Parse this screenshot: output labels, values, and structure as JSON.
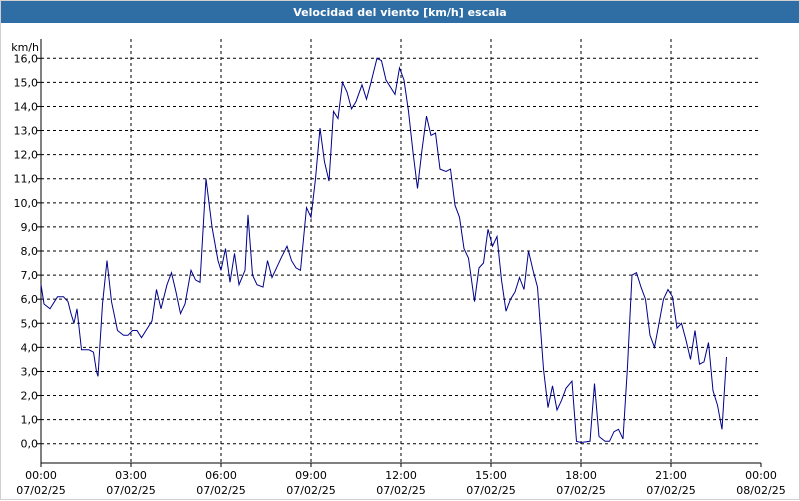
{
  "window": {
    "title": "Velocidad del viento [km/h] escala"
  },
  "colors": {
    "titlebar_bg": "#2f6ea5",
    "line": "#00008b",
    "grid": "#000000"
  },
  "chart_data": {
    "type": "line",
    "title": "Velocidad del viento [km/h] escala",
    "ylabel": "km/h",
    "ylim": [
      -0.8,
      16.8
    ],
    "xlim_hours": [
      0,
      24
    ],
    "y_ticks": [
      "0,0",
      "1,0",
      "2,0",
      "3,0",
      "4,0",
      "5,0",
      "6,0",
      "7,0",
      "8,0",
      "9,0",
      "10,0",
      "11,0",
      "12,0",
      "13,0",
      "14,0",
      "15,0",
      "16,0"
    ],
    "x_ticks": [
      {
        "time": "00:00",
        "date": "07/02/25"
      },
      {
        "time": "03:00",
        "date": "07/02/25"
      },
      {
        "time": "06:00",
        "date": "07/02/25"
      },
      {
        "time": "09:00",
        "date": "07/02/25"
      },
      {
        "time": "12:00",
        "date": "07/02/25"
      },
      {
        "time": "15:00",
        "date": "07/02/25"
      },
      {
        "time": "18:00",
        "date": "07/02/25"
      },
      {
        "time": "21:00",
        "date": "07/02/25"
      },
      {
        "time": "00:00",
        "date": "08/02/25"
      }
    ],
    "grid": true,
    "series": [
      {
        "values": [
          [
            0.0,
            6.6
          ],
          [
            0.1,
            5.8
          ],
          [
            0.3,
            5.6
          ],
          [
            0.55,
            6.1
          ],
          [
            0.75,
            6.1
          ],
          [
            0.9,
            5.9
          ],
          [
            1.0,
            5.4
          ],
          [
            1.1,
            5.0
          ],
          [
            1.2,
            5.6
          ],
          [
            1.35,
            3.9
          ],
          [
            1.6,
            3.9
          ],
          [
            1.75,
            3.8
          ],
          [
            1.85,
            3.0
          ],
          [
            1.9,
            2.8
          ],
          [
            2.05,
            5.8
          ],
          [
            2.2,
            7.6
          ],
          [
            2.35,
            5.9
          ],
          [
            2.55,
            4.7
          ],
          [
            2.75,
            4.5
          ],
          [
            2.9,
            4.5
          ],
          [
            3.05,
            4.7
          ],
          [
            3.2,
            4.7
          ],
          [
            3.35,
            4.4
          ],
          [
            3.55,
            4.8
          ],
          [
            3.7,
            5.1
          ],
          [
            3.85,
            6.4
          ],
          [
            4.0,
            5.6
          ],
          [
            4.2,
            6.6
          ],
          [
            4.35,
            7.1
          ],
          [
            4.5,
            6.3
          ],
          [
            4.65,
            5.4
          ],
          [
            4.8,
            5.8
          ],
          [
            5.0,
            7.2
          ],
          [
            5.15,
            6.8
          ],
          [
            5.3,
            6.7
          ],
          [
            5.5,
            11.0
          ],
          [
            5.7,
            9.0
          ],
          [
            5.9,
            7.6
          ],
          [
            6.0,
            7.2
          ],
          [
            6.15,
            8.1
          ],
          [
            6.3,
            6.7
          ],
          [
            6.45,
            7.9
          ],
          [
            6.6,
            6.6
          ],
          [
            6.8,
            7.2
          ],
          [
            6.9,
            9.5
          ],
          [
            7.05,
            7.0
          ],
          [
            7.2,
            6.6
          ],
          [
            7.4,
            6.5
          ],
          [
            7.55,
            7.6
          ],
          [
            7.7,
            6.9
          ],
          [
            7.85,
            7.3
          ],
          [
            8.0,
            7.7
          ],
          [
            8.2,
            8.2
          ],
          [
            8.35,
            7.6
          ],
          [
            8.5,
            7.3
          ],
          [
            8.65,
            7.2
          ],
          [
            8.85,
            9.8
          ],
          [
            9.0,
            9.4
          ],
          [
            9.15,
            11.0
          ],
          [
            9.3,
            13.1
          ],
          [
            9.45,
            11.7
          ],
          [
            9.6,
            10.9
          ],
          [
            9.75,
            13.8
          ],
          [
            9.9,
            13.5
          ],
          [
            10.05,
            15.0
          ],
          [
            10.2,
            14.6
          ],
          [
            10.35,
            13.9
          ],
          [
            10.5,
            14.2
          ],
          [
            10.7,
            14.9
          ],
          [
            10.85,
            14.3
          ],
          [
            11.0,
            15.0
          ],
          [
            11.2,
            16.0
          ],
          [
            11.35,
            15.9
          ],
          [
            11.5,
            15.1
          ],
          [
            11.65,
            14.8
          ],
          [
            11.8,
            14.5
          ],
          [
            11.95,
            15.6
          ],
          [
            12.1,
            15.1
          ],
          [
            12.25,
            13.8
          ],
          [
            12.4,
            12.1
          ],
          [
            12.55,
            10.6
          ],
          [
            12.7,
            12.2
          ],
          [
            12.85,
            13.6
          ],
          [
            13.0,
            12.8
          ],
          [
            13.15,
            12.9
          ],
          [
            13.3,
            11.4
          ],
          [
            13.5,
            11.3
          ],
          [
            13.65,
            11.4
          ],
          [
            13.8,
            9.9
          ],
          [
            13.95,
            9.4
          ],
          [
            14.1,
            8.1
          ],
          [
            14.25,
            7.7
          ],
          [
            14.45,
            5.9
          ],
          [
            14.6,
            7.3
          ],
          [
            14.75,
            7.5
          ],
          [
            14.9,
            8.9
          ],
          [
            15.05,
            8.2
          ],
          [
            15.2,
            8.6
          ],
          [
            15.35,
            6.8
          ],
          [
            15.5,
            5.5
          ],
          [
            15.65,
            6.0
          ],
          [
            15.8,
            6.3
          ],
          [
            15.95,
            6.9
          ],
          [
            16.1,
            6.4
          ],
          [
            16.25,
            8.0
          ],
          [
            16.4,
            7.2
          ],
          [
            16.55,
            6.5
          ],
          [
            16.75,
            3.1
          ],
          [
            16.9,
            1.5
          ],
          [
            17.05,
            2.4
          ],
          [
            17.2,
            1.4
          ],
          [
            17.35,
            1.8
          ],
          [
            17.5,
            2.3
          ],
          [
            17.7,
            2.6
          ],
          [
            17.85,
            0.1
          ],
          [
            18.0,
            0.05
          ],
          [
            18.3,
            0.1
          ],
          [
            18.45,
            2.5
          ],
          [
            18.6,
            0.3
          ],
          [
            18.8,
            0.1
          ],
          [
            18.95,
            0.1
          ],
          [
            19.1,
            0.5
          ],
          [
            19.25,
            0.6
          ],
          [
            19.4,
            0.2
          ],
          [
            19.55,
            3.2
          ],
          [
            19.7,
            7.0
          ],
          [
            19.85,
            7.1
          ],
          [
            20.0,
            6.5
          ],
          [
            20.15,
            6.0
          ],
          [
            20.3,
            4.5
          ],
          [
            20.45,
            4.0
          ],
          [
            20.6,
            5.0
          ],
          [
            20.75,
            6.0
          ],
          [
            20.9,
            6.4
          ],
          [
            21.05,
            6.1
          ],
          [
            21.2,
            4.8
          ],
          [
            21.35,
            5.0
          ],
          [
            21.5,
            4.3
          ],
          [
            21.65,
            3.5
          ],
          [
            21.8,
            4.7
          ],
          [
            21.95,
            3.3
          ],
          [
            22.1,
            3.4
          ],
          [
            22.25,
            4.2
          ],
          [
            22.4,
            2.2
          ],
          [
            22.55,
            1.6
          ],
          [
            22.7,
            0.6
          ],
          [
            22.85,
            3.6
          ]
        ]
      }
    ]
  }
}
